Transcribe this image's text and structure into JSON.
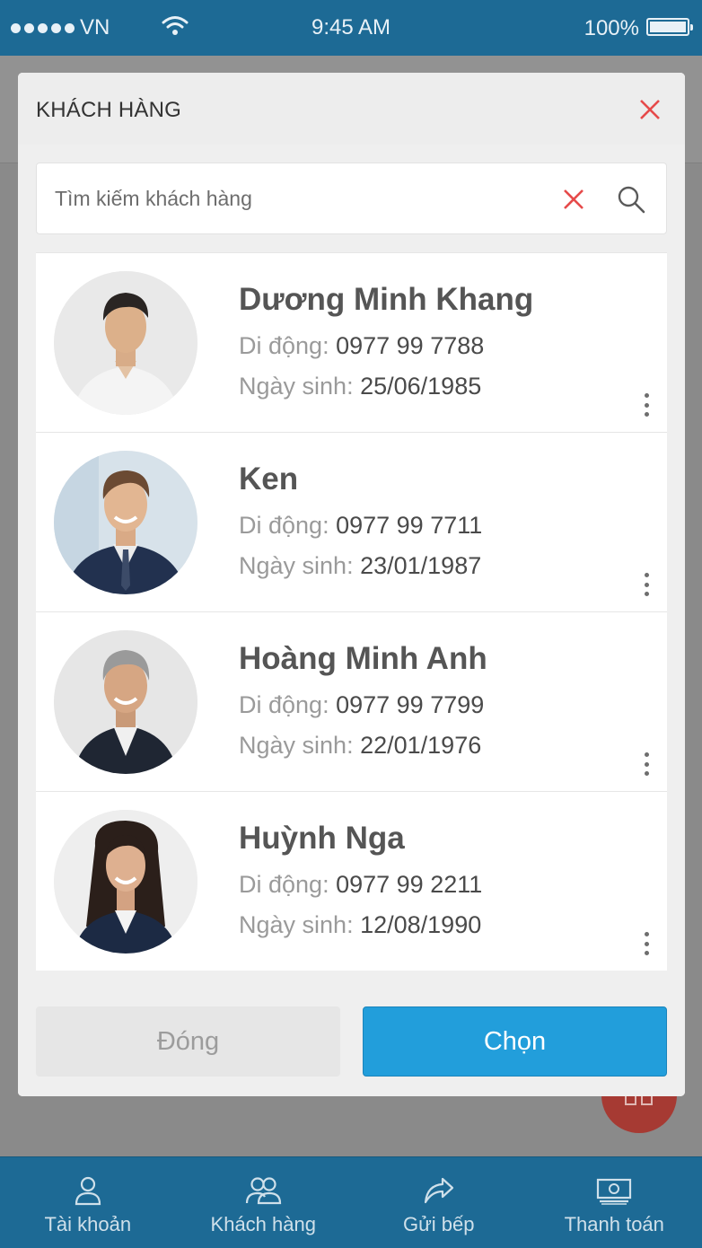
{
  "status_bar": {
    "carrier": "VN",
    "time": "9:45 AM",
    "battery": "100%"
  },
  "modal": {
    "title": "KHÁCH HÀNG",
    "search": {
      "placeholder": "Tìm kiếm khách hàng",
      "value": ""
    },
    "phone_label": "Di động:",
    "dob_label": "Ngày sinh:",
    "customers": [
      {
        "name": "Dương Minh Khang",
        "phone": "0977 99 7788",
        "dob": "25/06/1985"
      },
      {
        "name": "Ken",
        "phone": "0977 99 7711",
        "dob": "23/01/1987"
      },
      {
        "name": "Hoàng Minh Anh",
        "phone": "0977 99 7799",
        "dob": "22/01/1976"
      },
      {
        "name": "Huỳnh Nga",
        "phone": "0977 99 2211",
        "dob": "12/08/1990"
      }
    ],
    "buttons": {
      "close_label": "Đóng",
      "choose_label": "Chọn"
    }
  },
  "bottom_nav": [
    {
      "label": "Tài khoản",
      "icon": "user-icon"
    },
    {
      "label": "Khách hàng",
      "icon": "users-icon"
    },
    {
      "label": "Gửi bếp",
      "icon": "share-arrow-icon"
    },
    {
      "label": "Thanh toán",
      "icon": "cash-icon"
    }
  ],
  "colors": {
    "primary": "#1d6a95",
    "accent": "#229edb",
    "danger": "#e64a4a",
    "fab": "#a63a33"
  }
}
